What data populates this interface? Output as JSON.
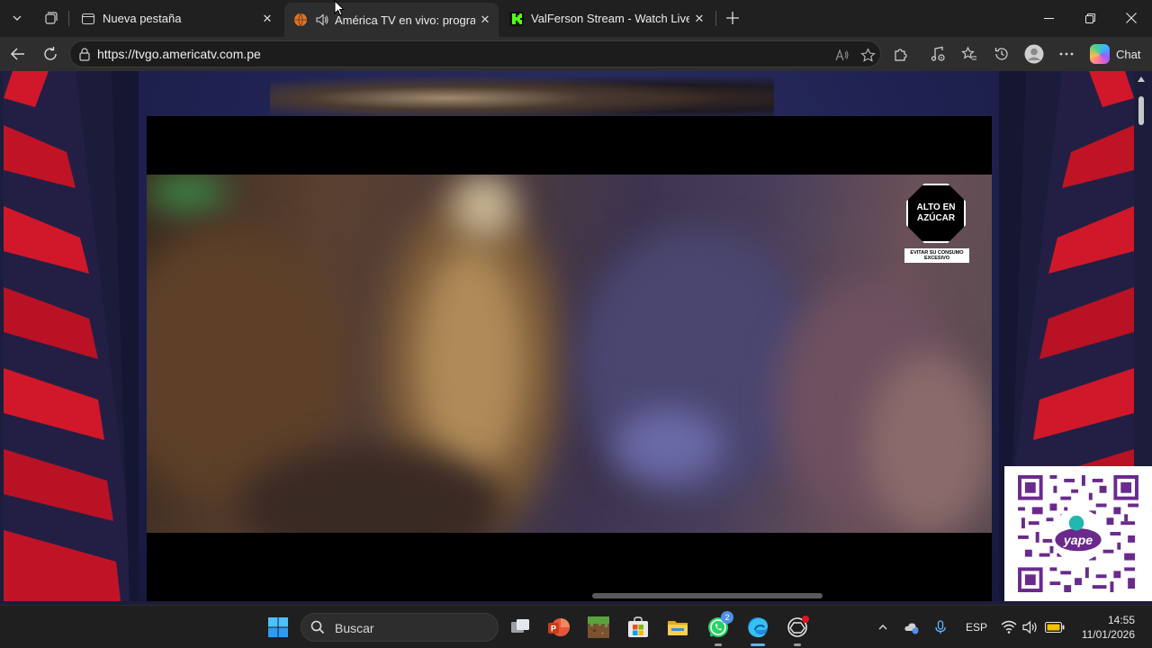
{
  "browser": {
    "tabs": [
      {
        "title": "Nueva pestaña",
        "active": false
      },
      {
        "title": "América TV en vivo: programa",
        "active": true
      },
      {
        "title": "ValFerson Stream - Watch Live on K",
        "active": false
      }
    ],
    "url": "https://tvgo.americatv.com.pe",
    "chat_label": "Chat"
  },
  "page": {
    "sugar_warning": {
      "line1": "ALTO EN",
      "line2": "AZÚCAR",
      "note1": "EVITAR SU CONSUMO",
      "note2": "EXCESIVO"
    },
    "qr_brand": "yape"
  },
  "taskbar": {
    "search_placeholder": "Buscar",
    "whatsapp_badge": "2",
    "language": "ESP",
    "time": "14:55",
    "date": "11/01/2026"
  },
  "colors": {
    "accent_red": "#d0182a",
    "page_navy": "#1f2250",
    "qr_purple": "#6a2a8c",
    "edge_blue": "#5fb4ff"
  }
}
